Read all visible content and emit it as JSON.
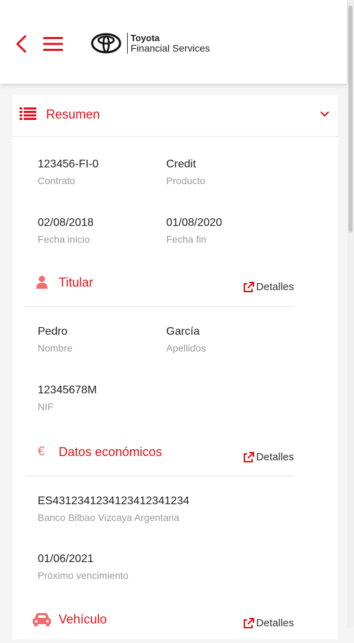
{
  "header": {
    "brand_name": "Toyota",
    "brand_sub": "Financial Services"
  },
  "summary": {
    "title": "Resumen",
    "contract": {
      "value": "123456-FI-0",
      "label": "Contrato"
    },
    "product": {
      "value": "Credit",
      "label": "Producto"
    },
    "start_date": {
      "value": "02/08/2018",
      "label": "Fecha inicio"
    },
    "end_date": {
      "value": "01/08/2020",
      "label": "Fecha fin"
    }
  },
  "titular": {
    "title": "Titular",
    "details_label": "Detalles",
    "first_name": {
      "value": "Pedro",
      "label": "Nombre"
    },
    "last_name": {
      "value": "García",
      "label": "Apellidos"
    },
    "nif": {
      "value": "12345678M",
      "label": "NIF"
    }
  },
  "economic": {
    "title": "Datos económicos",
    "icon_glyph": "€",
    "details_label": "Detalles",
    "iban": {
      "value": "ES4312341234123412341234",
      "label": "Banco Bilbao Vizcaya Argentaria"
    },
    "next_due": {
      "value": "01/06/2021",
      "label": "Próximo vencimiento"
    }
  },
  "vehicle": {
    "title": "Vehículo",
    "details_label": "Detalles"
  },
  "colors": {
    "accent": "#e0131b",
    "text": "#222222",
    "muted": "#9a9a9a"
  }
}
